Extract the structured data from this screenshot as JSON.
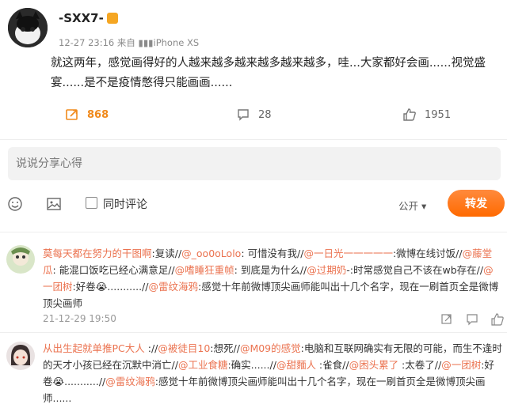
{
  "post": {
    "username": "-SXX7-",
    "meta": "12-27 23:16  来自  ▮▮▮iPhone XS",
    "text": "就这两年，感觉画得好的人越来越多越来越多越来越多，哇...大家都好会画......视觉盛宴......是不是疫情憋得只能画画......",
    "repost_count": "868",
    "comment_count": "28",
    "like_count": "1951"
  },
  "composer": {
    "placeholder": "说说分享心得",
    "sync_label": "同时评论",
    "visibility": "公开",
    "visibility_caret": "▾",
    "submit_label": "转发"
  },
  "comments": [
    {
      "user": "莫每天都在努力的干图啊",
      "segments": [
        {
          "t": ":复读//",
          "u": false
        },
        {
          "t": "@_oo0oLolo",
          "u": true
        },
        {
          "t": ": 可惜没有我//",
          "u": false
        },
        {
          "t": "@一日光一一一一一",
          "u": true
        },
        {
          "t": ":微博在线讨饭//",
          "u": false
        },
        {
          "t": "@藤堂瓜",
          "u": true
        },
        {
          "t": ": 能混口饭吃已经心满意足//",
          "u": false
        },
        {
          "t": "@嗜睡狂重帧",
          "u": true
        },
        {
          "t": ": 到底是为什么//",
          "u": false
        },
        {
          "t": "@过期奶",
          "u": true
        },
        {
          "t": "-:时常感觉自己不该在wb存在//",
          "u": false
        },
        {
          "t": "@一团树",
          "u": true
        },
        {
          "t": ":好卷😭...........//",
          "u": false
        },
        {
          "t": "@雷纹海鸦",
          "u": true
        },
        {
          "t": ":感觉十年前微博顶尖画师能叫出十几个名字，现在一刷首页全是微博顶尖画师",
          "u": false
        }
      ],
      "time": "21-12-29 19:50"
    },
    {
      "user": "从出生起就单推PC大人",
      "segments": [
        {
          "t": " ://",
          "u": false
        },
        {
          "t": "@被徒目10",
          "u": true
        },
        {
          "t": ":想死//",
          "u": false
        },
        {
          "t": "@M09的感觉",
          "u": true
        },
        {
          "t": ":电脑和互联网确实有无限的可能，而生不逢时的天才小孩已经在沉默中消亡//",
          "u": false
        },
        {
          "t": "@工业食糖",
          "u": true
        },
        {
          "t": ":确实......//",
          "u": false
        },
        {
          "t": "@甜麵人",
          "u": true
        },
        {
          "t": " :雀食//",
          "u": false
        },
        {
          "t": "@困头累了",
          "u": true
        },
        {
          "t": " :太卷了//",
          "u": false
        },
        {
          "t": "@一团树",
          "u": true
        },
        {
          "t": ":好卷😭...........//",
          "u": false
        },
        {
          "t": "@雷纹海鸦",
          "u": true
        },
        {
          "t": ":感觉十年前微博顶尖画师能叫出十几个名字，现在一刷首页全是微博顶尖画师......",
          "u": false
        }
      ],
      "time": ""
    }
  ]
}
